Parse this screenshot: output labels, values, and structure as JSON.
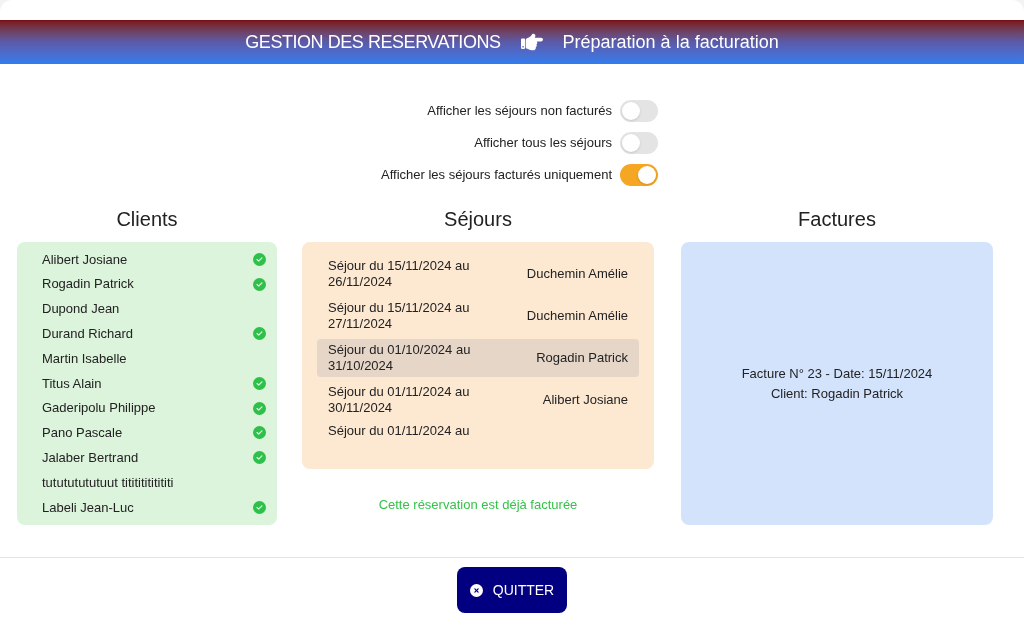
{
  "header": {
    "title": "GESTION DES RESERVATIONS",
    "subtitle": "Préparation à la facturation"
  },
  "filters": [
    {
      "label": "Afficher les séjours non facturés",
      "on": false
    },
    {
      "label": "Afficher tous les séjours",
      "on": false
    },
    {
      "label": "Afficher les séjours facturés uniquement",
      "on": true
    }
  ],
  "clients": {
    "title": "Clients",
    "items": [
      {
        "name": "Alibert Josiane",
        "billed": true
      },
      {
        "name": "Rogadin Patrick",
        "billed": true
      },
      {
        "name": "Dupond Jean",
        "billed": false
      },
      {
        "name": "Durand Richard",
        "billed": true
      },
      {
        "name": "Martin Isabelle",
        "billed": false
      },
      {
        "name": "Titus Alain",
        "billed": true
      },
      {
        "name": "Gaderipolu Philippe",
        "billed": true
      },
      {
        "name": "Pano Pascale",
        "billed": true
      },
      {
        "name": "Jalaber Bertrand",
        "billed": true
      },
      {
        "name": "tutututututuut titititititititi",
        "billed": false
      },
      {
        "name": "Labeli Jean-Luc",
        "billed": true
      }
    ]
  },
  "sejours": {
    "title": "Séjours",
    "items": [
      {
        "period": "Séjour du 15/11/2024 au 26/11/2024",
        "client": "Duchemin Amélie",
        "selected": false
      },
      {
        "period": "Séjour du 15/11/2024 au 27/11/2024",
        "client": "Duchemin Amélie",
        "selected": false
      },
      {
        "period": "Séjour du 01/10/2024 au 31/10/2024",
        "client": "Rogadin Patrick",
        "selected": true
      },
      {
        "period": "Séjour du 01/11/2024 au 30/11/2024",
        "client": "Alibert Josiane",
        "selected": false
      },
      {
        "period": "Séjour du 01/11/2024 au",
        "selected": false
      }
    ],
    "message": "Cette réservation est déjà facturée"
  },
  "factures": {
    "title": "Factures",
    "lines": [
      "Facture N° 23 - Date: 15/11/2024",
      "Client: Rogadin Patrick"
    ]
  },
  "quit_button": "QUITTER"
}
